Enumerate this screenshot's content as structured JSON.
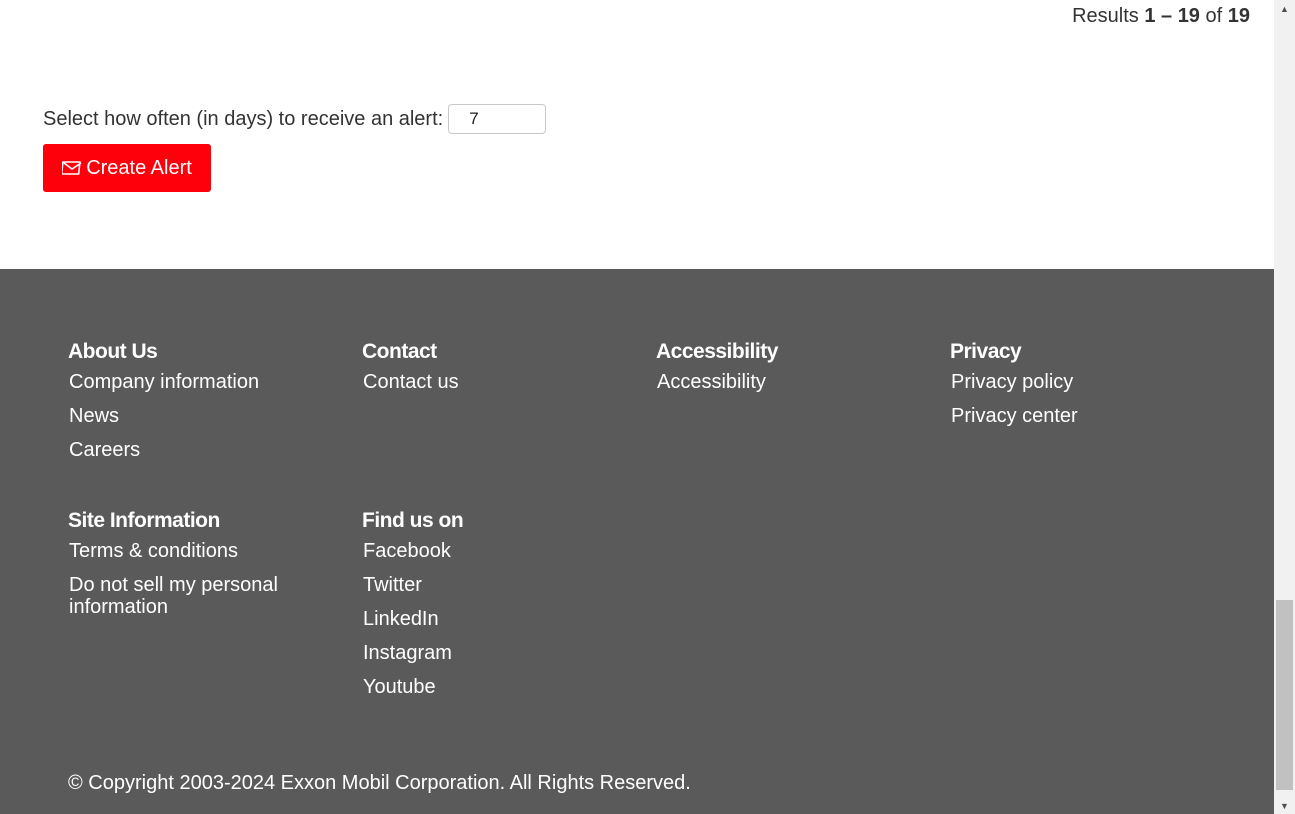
{
  "results": {
    "prefix": "Results",
    "range": "1 – 19",
    "of": "of",
    "total": "19"
  },
  "alert": {
    "label": "Select how often (in days) to receive an alert:",
    "days_value": "7",
    "button_label": "Create Alert",
    "button_icon": "envelope-icon"
  },
  "footer": {
    "about": {
      "heading": "About Us",
      "links": [
        "Company information",
        "News",
        "Careers"
      ]
    },
    "contact": {
      "heading": "Contact",
      "links": [
        "Contact us"
      ]
    },
    "accessibility": {
      "heading": "Accessibility",
      "links": [
        "Accessibility"
      ]
    },
    "privacy": {
      "heading": "Privacy",
      "links": [
        "Privacy policy",
        "Privacy center"
      ]
    },
    "site_info": {
      "heading": "Site Information",
      "links": [
        "Terms & conditions",
        "Do not sell my personal information"
      ]
    },
    "find_us": {
      "heading": "Find us on",
      "links": [
        "Facebook",
        "Twitter",
        "LinkedIn",
        "Instagram",
        "Youtube"
      ]
    },
    "copyright": "© Copyright 2003-2024 Exxon Mobil Corporation. All Rights Reserved."
  },
  "colors": {
    "button_red": "#fe000c",
    "footer_bg": "#5a5a5a"
  }
}
